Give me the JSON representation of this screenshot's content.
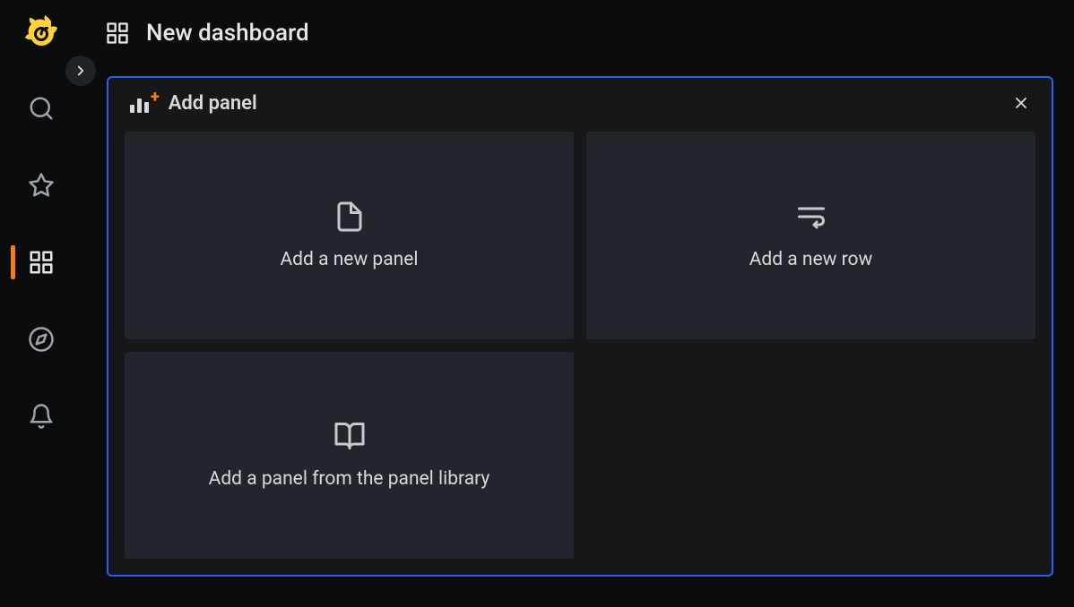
{
  "page": {
    "title": "New dashboard"
  },
  "add_panel": {
    "title": "Add panel",
    "options": {
      "new_panel": "Add a new panel",
      "new_row": "Add a new row",
      "panel_library": "Add a panel from the panel library"
    }
  }
}
